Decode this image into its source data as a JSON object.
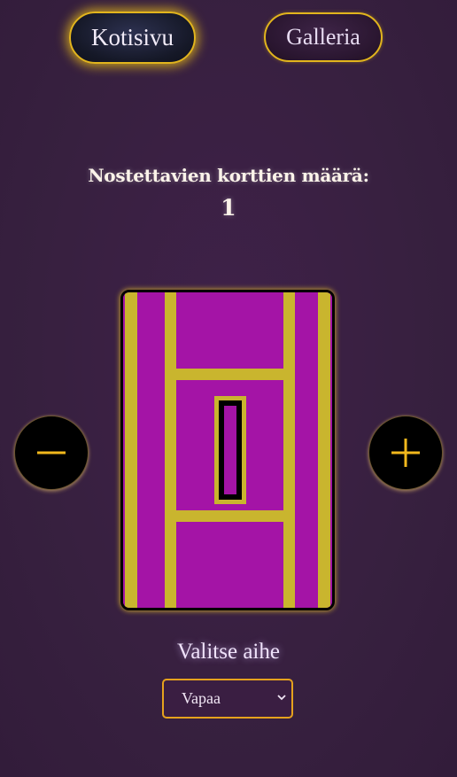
{
  "nav": {
    "home_label": "Kotisivu",
    "gallery_label": "Galleria"
  },
  "draw_count": {
    "label": "Nostettavien korttien määrä:",
    "value": "1"
  },
  "stepper": {
    "decrease_icon": "minus-icon",
    "increase_icon": "plus-icon"
  },
  "card": {
    "icon": "card-back-pattern",
    "colors": {
      "face": "#a414a6",
      "stripe": "#c9b52e",
      "border": "#000000"
    }
  },
  "topic": {
    "label": "Valitse aihe",
    "selected": "Vapaa"
  },
  "colors": {
    "accent": "#e2b51d",
    "background": "#3a1f43"
  }
}
